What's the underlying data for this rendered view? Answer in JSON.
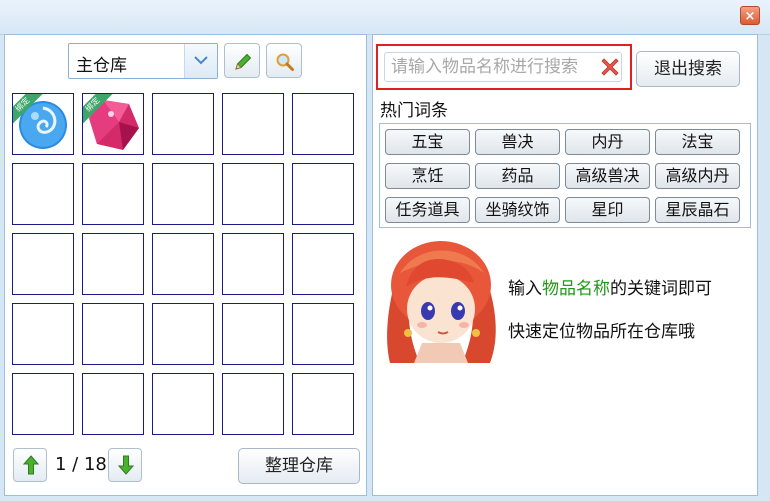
{
  "window": {
    "close_label": "×"
  },
  "warehouse": {
    "selected": "主仓库",
    "pagination": {
      "text": "1 / 18"
    },
    "sort_button": "整理仓库",
    "slots": [
      {
        "item": "blue-orb",
        "badge": "绑定"
      },
      {
        "item": "pink-crystal",
        "badge": "绑定"
      },
      {},
      {},
      {},
      {},
      {},
      {},
      {},
      {},
      {},
      {},
      {},
      {},
      {},
      {},
      {},
      {},
      {},
      {},
      {},
      {},
      {},
      {},
      {}
    ]
  },
  "search": {
    "placeholder": "请输入物品名称进行搜索",
    "value": "",
    "exit_button": "退出搜索"
  },
  "hot": {
    "title": "热门词条",
    "tags": [
      "五宝",
      "兽决",
      "内丹",
      "法宝",
      "烹饪",
      "药品",
      "高级兽决",
      "高级内丹",
      "任务道具",
      "坐骑纹饰",
      "星印",
      "星辰晶石"
    ]
  },
  "tips": {
    "line1_pre": "输入",
    "line1_highlight": "物品名称",
    "line1_post": "的关键词即可",
    "line2": "快速定位物品所在仓库哦"
  },
  "colors": {
    "highlight": "#1d9a19",
    "search_border": "#e21f1f",
    "slot_border": "#1a1a8c"
  }
}
